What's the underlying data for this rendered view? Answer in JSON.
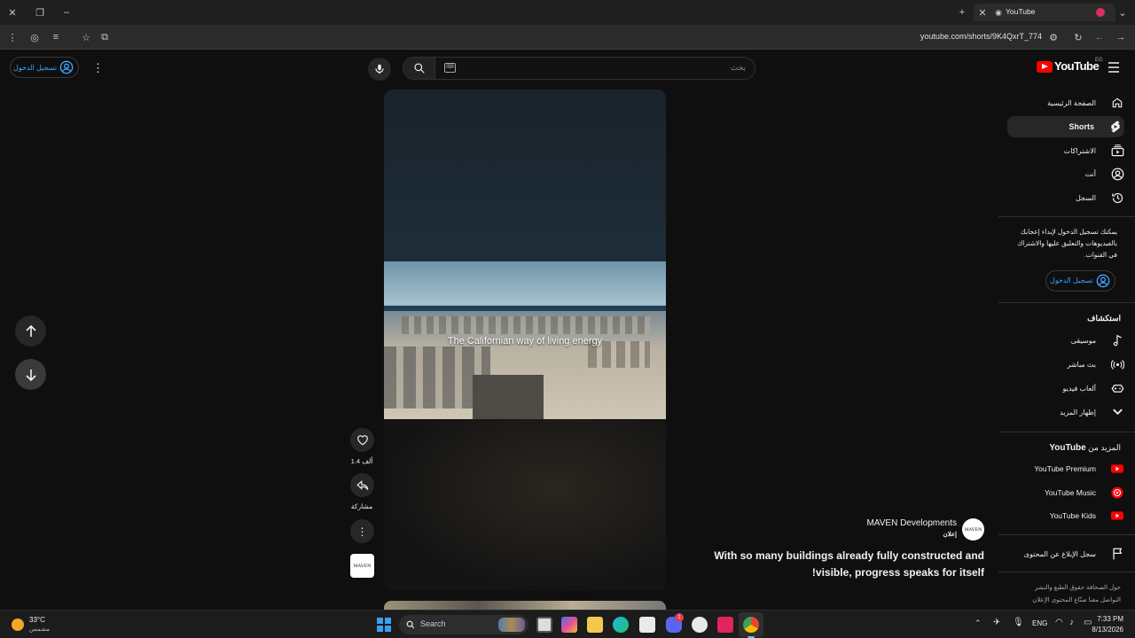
{
  "browser": {
    "tab_title": "YouTube",
    "url": "youtube.com/shorts/9K4QxrT_774"
  },
  "header": {
    "logo_text": "YouTube",
    "region": "EG",
    "search_placeholder": "بحث",
    "signin_label": "تسجيل الدخول"
  },
  "sidebar": {
    "nav": [
      {
        "label": "الصفحة الرئيسية",
        "icon": "home-icon"
      },
      {
        "label": "Shorts",
        "icon": "shorts-icon"
      },
      {
        "label": "الاشتراكات",
        "icon": "subscriptions-icon"
      },
      {
        "label": "أنت",
        "icon": "you-icon"
      },
      {
        "label": "السجل",
        "icon": "history-icon"
      }
    ],
    "signin_prompt": "يمكنك تسجيل الدخول لإبداء إعجابك بالفيديوهات والتعليق عليها والاشتراك في القنوات.",
    "signin_label": "تسجيل الدخول",
    "explore_heading": "استكشاف",
    "explore": [
      {
        "label": "موسيقى",
        "icon": "music-icon"
      },
      {
        "label": "بث مباشر",
        "icon": "live-icon"
      },
      {
        "label": "ألعاب فيديو",
        "icon": "gaming-icon"
      },
      {
        "label": "إظهار المزيد",
        "icon": "chevron-down-icon"
      }
    ],
    "more_heading_prefix": "المزيد من",
    "more_heading_brand": "YouTube",
    "more": [
      {
        "label": "YouTube Premium"
      },
      {
        "label": "YouTube Music"
      },
      {
        "label": "YouTube Kids"
      }
    ],
    "report_label": "سجل الإبلاغ عن المحتوى",
    "footer_line1": "حول  الصحافة  حقوق الطبع والنشر",
    "footer_line2": "التواصل معنا  صنّاع المحتوى  الإعلان"
  },
  "video": {
    "overlay_text": "The Californian way of living energy",
    "likes": "1.4 ألف",
    "share_label": "مشاركة",
    "channel_name": "MAVEN Developments",
    "channel_logo_text": "MAVEN",
    "sponsored_label": "إعلان",
    "title_line1": "With so many buildings already fully constructed and",
    "title_line2": "!visible, progress speaks for itself"
  },
  "taskbar": {
    "weather_temp": "33°C",
    "weather_desc": "مشمس",
    "search_label": "Search",
    "lang": "ENG",
    "time": "7:33 PM",
    "date": "8/13/2026",
    "badge_count": "1"
  },
  "colors": {
    "accent_blue": "#3ea6ff",
    "youtube_red": "#ff0000",
    "background": "#0f0f0f"
  }
}
